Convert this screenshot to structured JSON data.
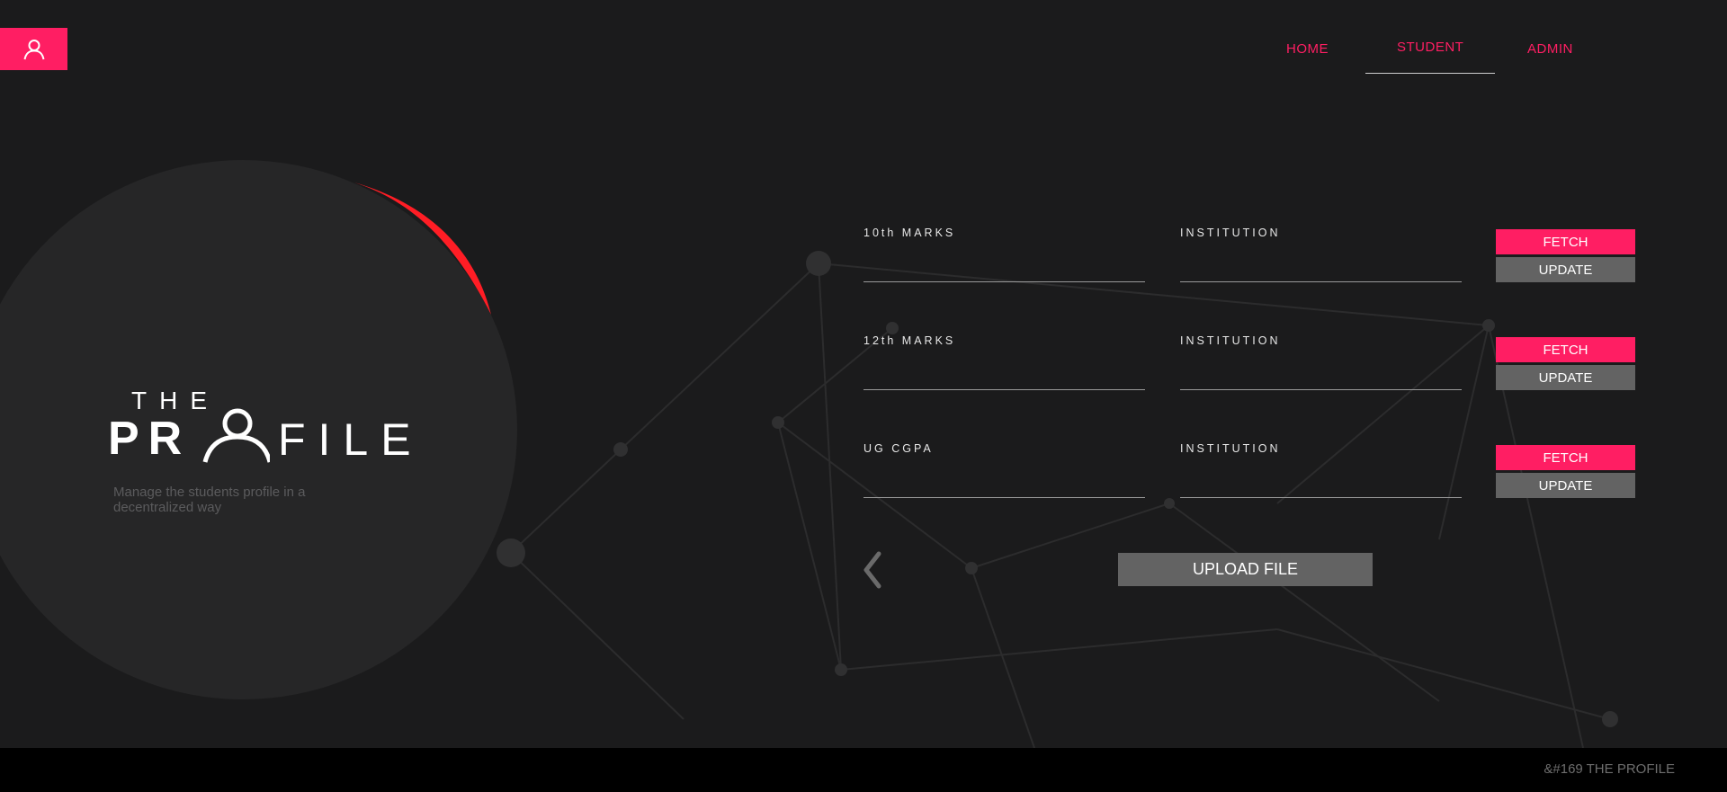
{
  "header": {
    "user_icon": "user-icon",
    "nav": {
      "home": "HOME",
      "student": "STUDENT",
      "admin": "ADMIN"
    }
  },
  "hero": {
    "logo_the": "THE",
    "logo_pr": "PR",
    "logo_file": "FILE",
    "tagline": "Manage the students profile in a decentralized way"
  },
  "form": {
    "rows": [
      {
        "marks_label": "10th MARKS",
        "institution_label": "INSTITUTION",
        "marks_value": "",
        "institution_value": "",
        "fetch": "FETCH",
        "update": "UPDATE"
      },
      {
        "marks_label": "12th MARKS",
        "institution_label": "INSTITUTION",
        "marks_value": "",
        "institution_value": "",
        "fetch": "FETCH",
        "update": "UPDATE"
      },
      {
        "marks_label": "UG CGPA",
        "institution_label": "INSTITUTION",
        "marks_value": "",
        "institution_value": "",
        "fetch": "FETCH",
        "update": "UPDATE"
      }
    ],
    "back_icon": "chevron-left-icon",
    "upload_label": "UPLOAD FILE"
  },
  "footer": {
    "text": "&#169 THE PROFILE"
  },
  "colors": {
    "accent": "#ff1e63",
    "arc": "#ff1d25",
    "background": "#1b1b1c",
    "circle": "#262627",
    "button_gray": "#636363"
  }
}
